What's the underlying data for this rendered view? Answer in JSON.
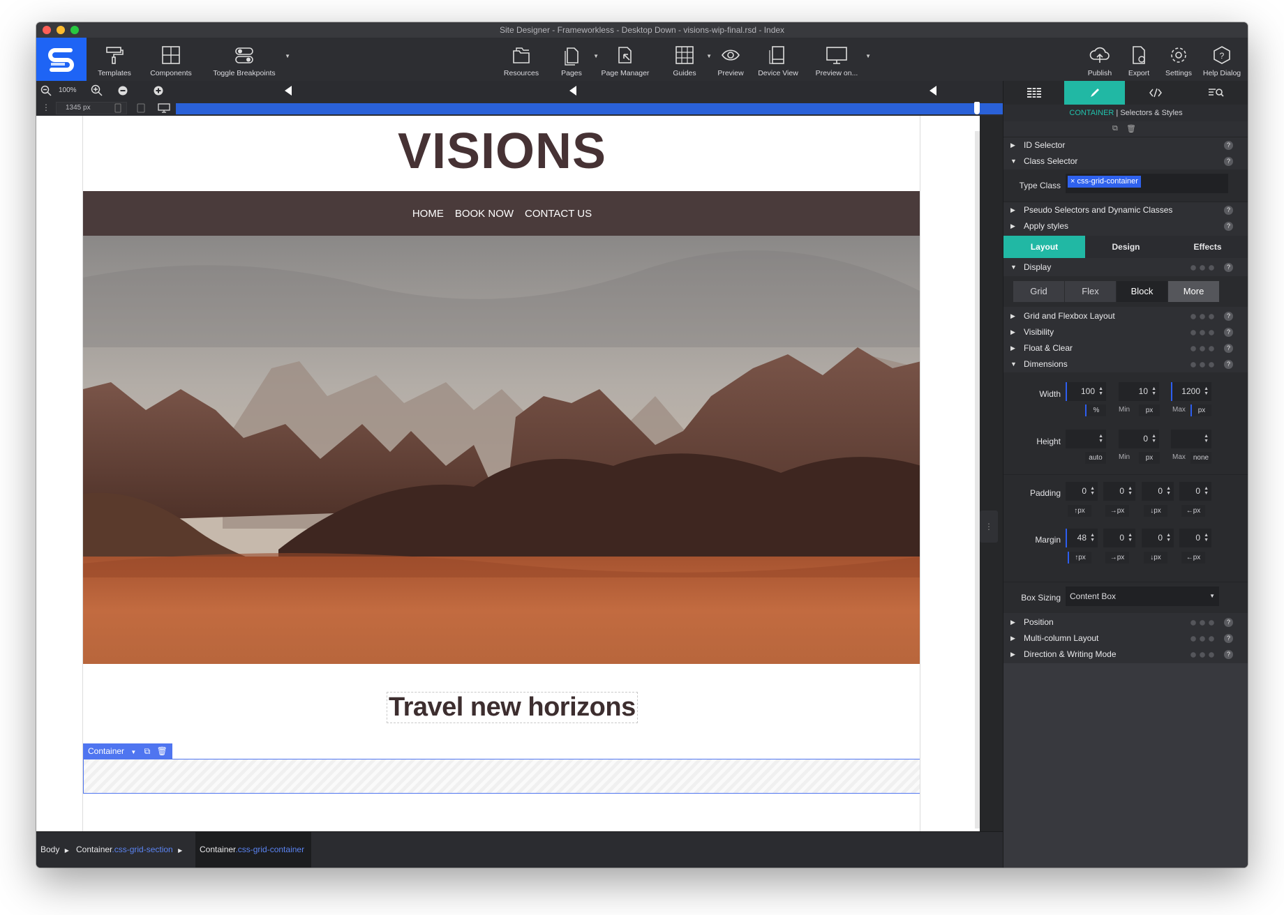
{
  "window": {
    "title": "Site Designer - Frameworkless - Desktop Down - visions-wip-final.rsd - Index"
  },
  "toolbar": {
    "left": [
      {
        "name": "templates",
        "label": "Templates"
      },
      {
        "name": "components",
        "label": "Components"
      },
      {
        "name": "toggle-breakpoints",
        "label": "Toggle Breakpoints"
      }
    ],
    "center": [
      {
        "name": "resources",
        "label": "Resources"
      },
      {
        "name": "pages",
        "label": "Pages"
      },
      {
        "name": "page-manager",
        "label": "Page Manager"
      },
      {
        "name": "guides",
        "label": "Guides"
      },
      {
        "name": "preview",
        "label": "Preview"
      },
      {
        "name": "device-view",
        "label": "Device View"
      },
      {
        "name": "preview-on",
        "label": "Preview on..."
      }
    ],
    "right": [
      {
        "name": "publish",
        "label": "Publish"
      },
      {
        "name": "export",
        "label": "Export"
      },
      {
        "name": "settings",
        "label": "Settings"
      },
      {
        "name": "help-dialog",
        "label": "Help Dialog"
      }
    ]
  },
  "zoom": {
    "value": "100%"
  },
  "ruler": {
    "width": "1345 px"
  },
  "site": {
    "brand": "VISIONS",
    "nav": [
      "HOME",
      "BOOK NOW",
      "CONTACT US"
    ],
    "headline": "Travel new horizons",
    "hero_alt": "desert-mountains-photo"
  },
  "selection": {
    "tag": "Container"
  },
  "breadcrumb": [
    {
      "name": "Body",
      "cls": ""
    },
    {
      "name": "Container",
      "cls": ".css-grid-section"
    },
    {
      "name": "Container",
      "cls": ".css-grid-container"
    }
  ],
  "panel": {
    "header_prefix": "CONTAINER",
    "header_rest": "Selectors & Styles",
    "id_selector": "ID Selector",
    "class_selector": "Class Selector",
    "type_class_label": "Type Class",
    "class_tag": "css-grid-container",
    "pseudo": "Pseudo Selectors and Dynamic Classes",
    "apply_styles": "Apply styles",
    "tabs": [
      "Layout",
      "Design",
      "Effects"
    ],
    "display": "Display",
    "display_opts": [
      "Grid",
      "Flex",
      "Block",
      "More"
    ],
    "grid_flex": "Grid and Flexbox Layout",
    "visibility": "Visibility",
    "float_clear": "Float & Clear",
    "dimensions": "Dimensions",
    "width": {
      "label": "Width",
      "value": "100",
      "unit": "%",
      "min": "10",
      "min_unit": "px",
      "max": "1200",
      "max_unit": "px",
      "min_label": "Min",
      "max_label": "Max"
    },
    "height": {
      "label": "Height",
      "value": "",
      "unit": "auto",
      "min": "0",
      "min_unit": "px",
      "max": "",
      "max_unit": "none",
      "min_label": "Min",
      "max_label": "Max"
    },
    "padding": {
      "label": "Padding",
      "values": [
        "0",
        "0",
        "0",
        "0"
      ],
      "units": [
        "↑px",
        "→px",
        "↓px",
        "←px"
      ]
    },
    "margin": {
      "label": "Margin",
      "values": [
        "48",
        "0",
        "0",
        "0"
      ],
      "units": [
        "↑px",
        "→px",
        "↓px",
        "←px"
      ]
    },
    "box_sizing": {
      "label": "Box Sizing",
      "value": "Content Box"
    },
    "position": "Position",
    "multicolumn": "Multi-column Layout",
    "direction": "Direction & Writing Mode"
  }
}
